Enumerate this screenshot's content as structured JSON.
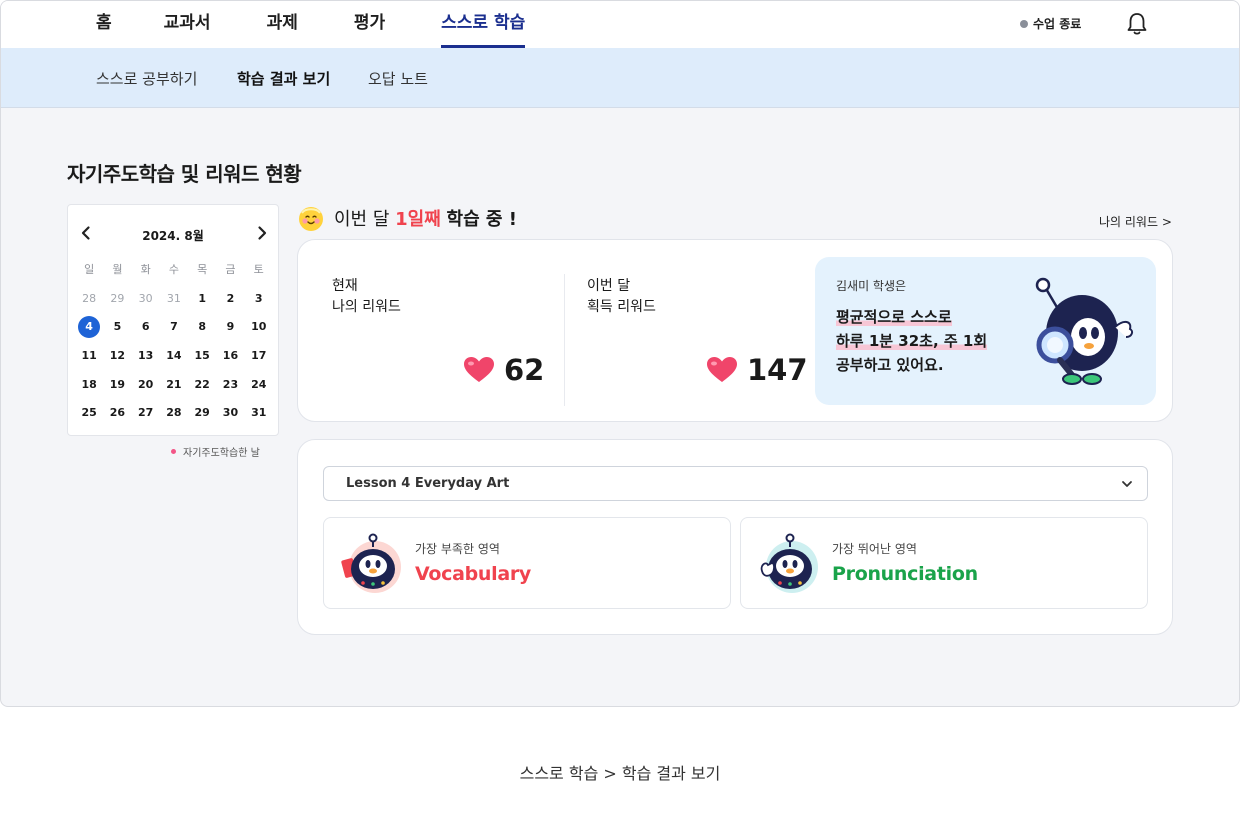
{
  "nav": {
    "items": [
      {
        "label": "홈",
        "active": false
      },
      {
        "label": "교과서",
        "active": false
      },
      {
        "label": "과제",
        "active": false
      },
      {
        "label": "평가",
        "active": false
      },
      {
        "label": "스스로 학습",
        "active": true
      }
    ],
    "class_end": "수업 종료",
    "bell_icon": "bell-icon"
  },
  "subnav": {
    "items": [
      {
        "label": "스스로 공부하기",
        "active": false
      },
      {
        "label": "학습 결과 보기",
        "active": true
      },
      {
        "label": "오답 노트",
        "active": false
      }
    ]
  },
  "page_title": "자기주도학습 및 리워드 현황",
  "calendar": {
    "month_label": "2024. 8월",
    "weekdays": [
      "일",
      "월",
      "화",
      "수",
      "목",
      "금",
      "토"
    ],
    "weeks": [
      [
        "28",
        "29",
        "30",
        "31",
        "1",
        "2",
        "3"
      ],
      [
        "4",
        "5",
        "6",
        "7",
        "8",
        "9",
        "10"
      ],
      [
        "11",
        "12",
        "13",
        "14",
        "15",
        "16",
        "17"
      ],
      [
        "18",
        "19",
        "20",
        "21",
        "22",
        "23",
        "24"
      ],
      [
        "25",
        "26",
        "27",
        "28",
        "29",
        "30",
        "31"
      ]
    ],
    "today": "4",
    "legend": "자기주도학습한 날"
  },
  "streak": {
    "prefix": "이번 달",
    "highlight": "1일째",
    "suffix": "학습 중 !"
  },
  "my_reward_link": "나의 리워드 >",
  "rewards": {
    "current": {
      "line1": "현재",
      "line2": "나의 리워드",
      "value": "62"
    },
    "month": {
      "line1": "이번 달",
      "line2": "획득 리워드",
      "value": "147"
    },
    "heart_color": "#f0456a"
  },
  "tip": {
    "who": "김새미 학생은",
    "line1": "평균적으로 스스로",
    "line2": "하루 1분 32초, 주 1회",
    "line3": "공부하고 있어요."
  },
  "lesson": {
    "selected": "Lesson 4 Everyday Art",
    "weak": {
      "caption": "가장 부족한 영역",
      "value": "Vocabulary",
      "color": "#f0434e"
    },
    "strong": {
      "caption": "가장 뛰어난 영역",
      "value": "Pronunciation",
      "color": "#1aa34a"
    }
  },
  "footer_caption": "스스로 학습 > 학습 결과 보기"
}
